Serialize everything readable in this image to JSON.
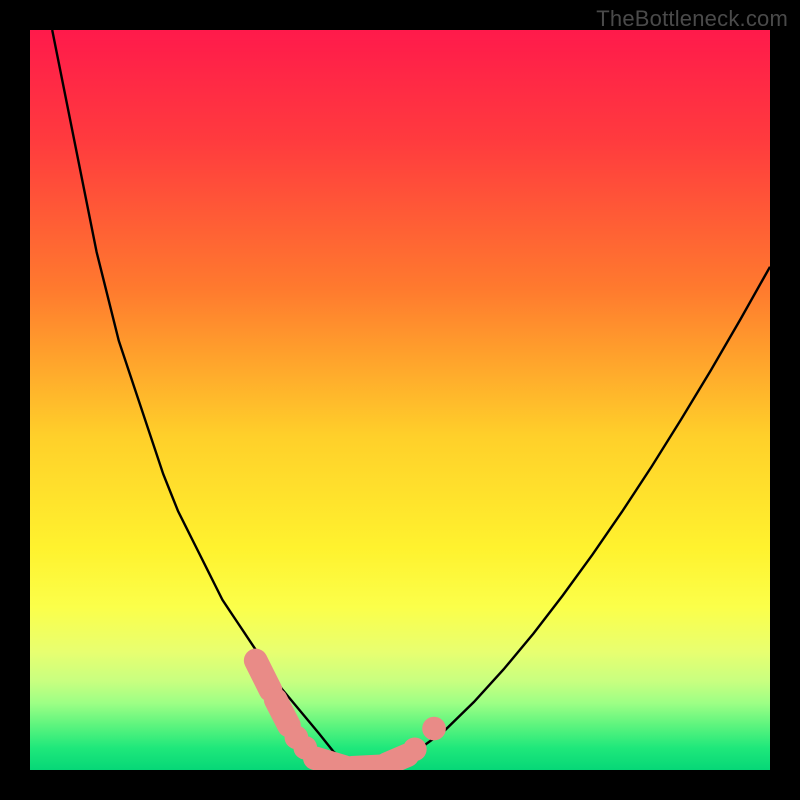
{
  "watermark": "TheBottleneck.com",
  "chart_data": {
    "type": "line",
    "title": "",
    "xlabel": "",
    "ylabel": "",
    "xlim": [
      0,
      100
    ],
    "ylim": [
      0,
      100
    ],
    "background_gradient": {
      "stops": [
        {
          "pos": 0.0,
          "color": "#ff1a4b"
        },
        {
          "pos": 0.15,
          "color": "#ff3b3e"
        },
        {
          "pos": 0.35,
          "color": "#ff7a2e"
        },
        {
          "pos": 0.55,
          "color": "#ffd02a"
        },
        {
          "pos": 0.7,
          "color": "#fff22e"
        },
        {
          "pos": 0.78,
          "color": "#fbff4a"
        },
        {
          "pos": 0.84,
          "color": "#e8ff70"
        },
        {
          "pos": 0.88,
          "color": "#c8ff80"
        },
        {
          "pos": 0.91,
          "color": "#9cff85"
        },
        {
          "pos": 0.94,
          "color": "#5cf47e"
        },
        {
          "pos": 0.97,
          "color": "#1fe87b"
        },
        {
          "pos": 1.0,
          "color": "#06d777"
        }
      ]
    },
    "series": [
      {
        "name": "curve",
        "color": "#000000",
        "x": [
          3,
          4,
          5,
          6,
          7,
          8,
          9,
          10,
          11,
          12,
          13,
          14,
          15,
          16,
          17,
          18,
          19,
          20,
          21,
          22,
          23,
          24,
          25,
          26,
          27,
          28,
          29,
          30,
          31,
          32,
          33,
          34,
          35,
          36,
          37,
          38,
          39,
          41,
          43,
          45,
          48,
          52,
          56,
          60,
          64,
          68,
          72,
          76,
          80,
          84,
          88,
          92,
          96,
          100
        ],
        "y": [
          100,
          95,
          90,
          85,
          80,
          75,
          70,
          66,
          62,
          58,
          55,
          52,
          49,
          46,
          43,
          40,
          37.5,
          35,
          33,
          31,
          29,
          27,
          25,
          23,
          21.5,
          20,
          18.5,
          17,
          15.5,
          14,
          12.5,
          11,
          9.8,
          8.6,
          7.4,
          6.2,
          5.0,
          2.5,
          0.8,
          0.5,
          0.9,
          2.4,
          5.3,
          9.2,
          13.6,
          18.4,
          23.6,
          29.1,
          34.9,
          41.0,
          47.4,
          54.0,
          60.9,
          68.0
        ]
      }
    ],
    "markers": [
      {
        "name": "pill-1",
        "shape": "pill",
        "x1": 30.5,
        "y1": 14.8,
        "x2": 32.5,
        "y2": 10.8,
        "color": "#e98b87",
        "width": 3.2
      },
      {
        "name": "pill-2",
        "shape": "pill",
        "x1": 33.2,
        "y1": 9.5,
        "x2": 35.0,
        "y2": 6.0,
        "color": "#e98b87",
        "width": 3.2
      },
      {
        "name": "dot-1",
        "shape": "dot",
        "x": 36.0,
        "y": 4.4,
        "r": 1.6,
        "color": "#e98b87"
      },
      {
        "name": "dot-2",
        "shape": "dot",
        "x": 37.2,
        "y": 3.0,
        "r": 1.6,
        "color": "#e98b87"
      },
      {
        "name": "pill-3",
        "shape": "pill",
        "x1": 38.5,
        "y1": 1.6,
        "x2": 42.5,
        "y2": 0.4,
        "color": "#e98b87",
        "width": 3.2
      },
      {
        "name": "pill-4",
        "shape": "pill",
        "x1": 43.5,
        "y1": 0.3,
        "x2": 47.5,
        "y2": 0.5,
        "color": "#e98b87",
        "width": 3.2
      },
      {
        "name": "pill-5",
        "shape": "pill",
        "x1": 48.2,
        "y1": 0.8,
        "x2": 51.0,
        "y2": 2.0,
        "color": "#e98b87",
        "width": 3.2
      },
      {
        "name": "dot-3",
        "shape": "dot",
        "x": 52.0,
        "y": 2.8,
        "r": 1.6,
        "color": "#e98b87"
      },
      {
        "name": "dot-4",
        "shape": "dot",
        "x": 54.6,
        "y": 5.6,
        "r": 1.6,
        "color": "#e98b87"
      }
    ]
  }
}
